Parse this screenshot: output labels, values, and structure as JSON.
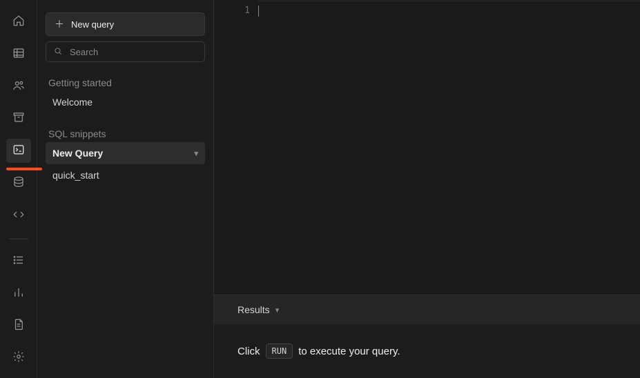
{
  "sidebar": {
    "new_query_btn": "New query",
    "search_placeholder": "Search",
    "sections": {
      "getting_started": {
        "label": "Getting started",
        "items": [
          {
            "label": "Welcome"
          }
        ]
      },
      "sql_snippets": {
        "label": "SQL snippets",
        "items": [
          {
            "label": "New Query",
            "active": true
          },
          {
            "label": "quick_start"
          }
        ]
      }
    }
  },
  "editor": {
    "line_numbers": [
      "1"
    ]
  },
  "results": {
    "header": "Results",
    "hint_before": "Click",
    "run_label": "RUN",
    "hint_after": "to execute your query."
  }
}
